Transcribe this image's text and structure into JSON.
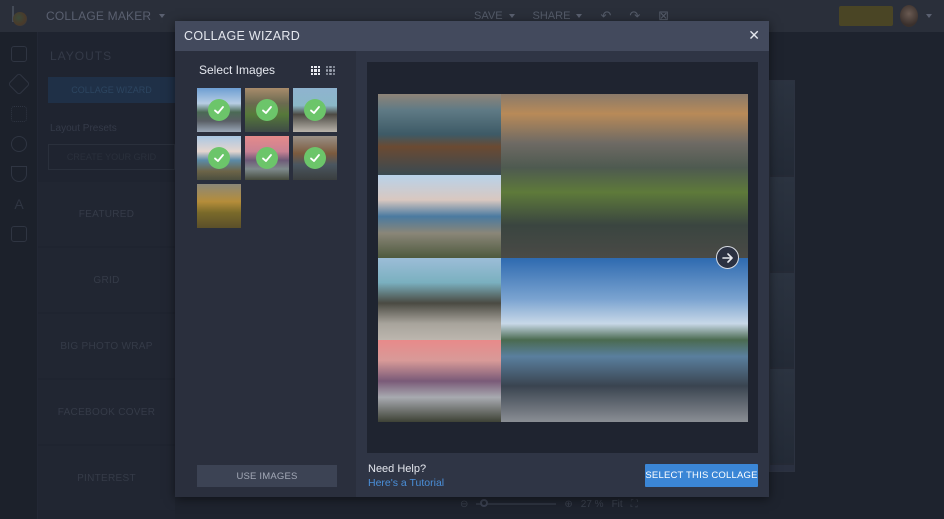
{
  "topbar": {
    "app_menu_label": "COLLAGE MAKER",
    "save_label": "SAVE",
    "share_label": "SHARE",
    "upgrade_label": "",
    "icons": [
      "undo-icon",
      "redo-icon",
      "close-project-icon"
    ]
  },
  "sidebar": {
    "title": "LAYOUTS",
    "wizard_button": "COLLAGE WIZARD",
    "presets_label": "Layout Presets",
    "create_grid_button": "CREATE YOUR GRID",
    "cards": [
      {
        "label": "FEATURED"
      },
      {
        "label": "GRID"
      },
      {
        "label": "BIG PHOTO WRAP"
      },
      {
        "label": "FACEBOOK COVER"
      },
      {
        "label": "PINTEREST"
      }
    ],
    "rail_icons": [
      "layouts-icon",
      "edit-icon",
      "grid-icon",
      "stickers-icon",
      "frames-icon",
      "text-icon",
      "textures-icon"
    ]
  },
  "zoombar": {
    "zoom_level": "27 %",
    "fit_label": "Fit",
    "slider_fraction": 0.05
  },
  "modal": {
    "title": "COLLAGE WIZARD",
    "close_symbol": "✕",
    "select_images_label": "Select Images",
    "thumbnails": [
      {
        "name": "coast-rocks-blue-sky",
        "selected": true
      },
      {
        "name": "green-cliff-sunset",
        "selected": true
      },
      {
        "name": "beach-boulders",
        "selected": true
      },
      {
        "name": "rocky-shore-pools",
        "selected": true
      },
      {
        "name": "pink-sky-arch",
        "selected": true
      },
      {
        "name": "sea-stacks",
        "selected": true
      },
      {
        "name": "golden-hills",
        "selected": false
      }
    ],
    "use_images_button": "USE IMAGES",
    "help_question": "Need Help?",
    "help_link": "Here's a Tutorial",
    "select_collage_button": "SELECT THIS COLLAGE",
    "accent_color": "#3b86d6",
    "check_color": "#6cc56a"
  }
}
